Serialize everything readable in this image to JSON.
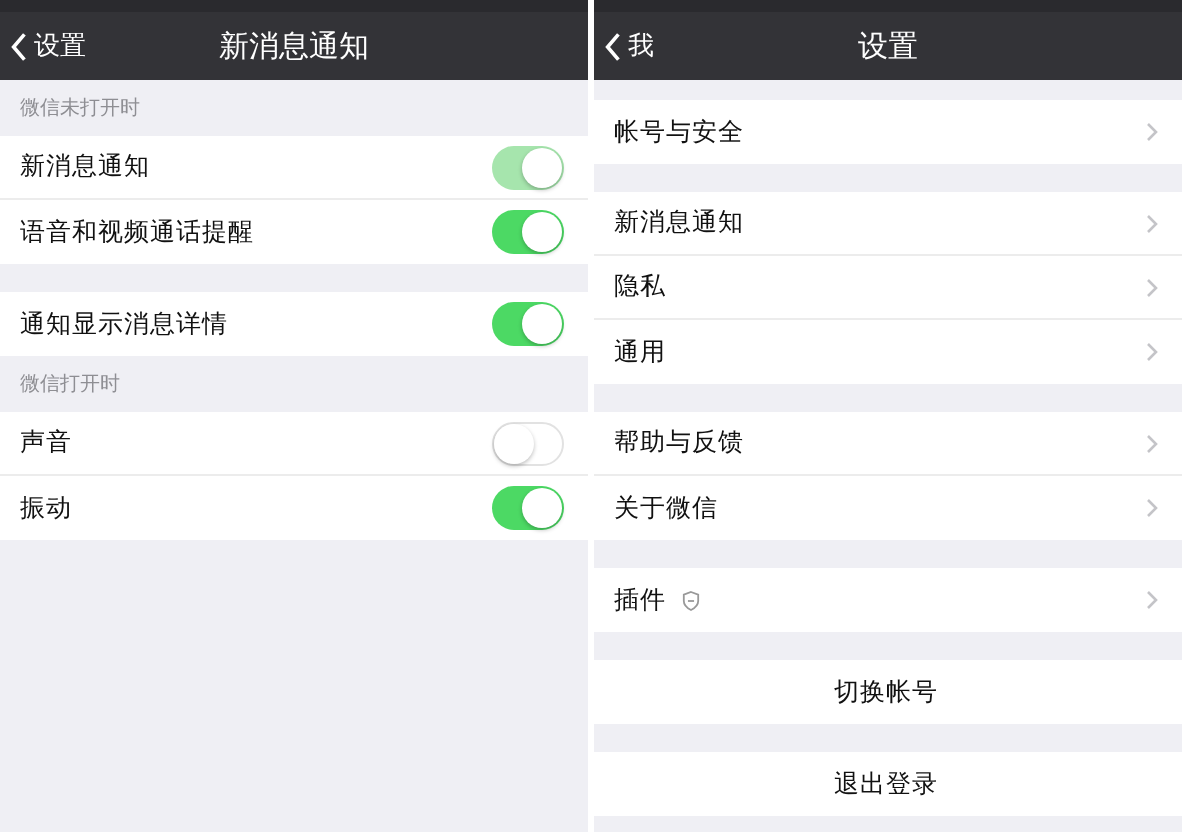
{
  "left_screen": {
    "nav": {
      "back": "设置",
      "title": "新消息通知"
    },
    "groups": [
      {
        "header": "微信未打开时",
        "rows": [
          {
            "label": "新消息通知",
            "on": true,
            "disabled": true
          },
          {
            "label": "语音和视频通话提醒",
            "on": true,
            "disabled": false
          }
        ]
      },
      {
        "rows": [
          {
            "label": "通知显示消息详情",
            "on": true,
            "disabled": false
          }
        ]
      },
      {
        "header": "微信打开时",
        "rows": [
          {
            "label": "声音",
            "on": false,
            "disabled": false
          },
          {
            "label": "振动",
            "on": true,
            "disabled": false
          }
        ]
      }
    ]
  },
  "right_screen": {
    "nav": {
      "back": "我",
      "title": "设置"
    },
    "groups": [
      {
        "rows": [
          {
            "label": "帐号与安全",
            "kind": "link"
          }
        ]
      },
      {
        "rows": [
          {
            "label": "新消息通知",
            "kind": "link"
          },
          {
            "label": "隐私",
            "kind": "link"
          },
          {
            "label": "通用",
            "kind": "link"
          }
        ]
      },
      {
        "rows": [
          {
            "label": "帮助与反馈",
            "kind": "link"
          },
          {
            "label": "关于微信",
            "kind": "link"
          }
        ]
      },
      {
        "rows": [
          {
            "label": "插件",
            "kind": "link",
            "icon": true
          }
        ]
      },
      {
        "rows": [
          {
            "label": "切换帐号",
            "kind": "action"
          }
        ]
      },
      {
        "rows": [
          {
            "label": "退出登录",
            "kind": "action"
          }
        ]
      }
    ]
  }
}
